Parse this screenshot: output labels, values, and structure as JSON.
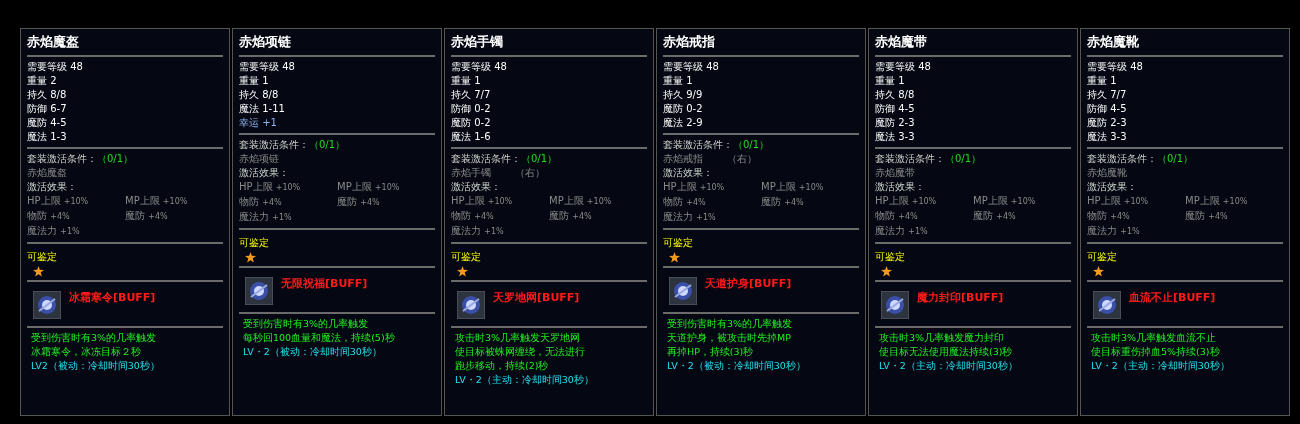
{
  "items": [
    {
      "name": "赤焰魔盔",
      "stats": [
        {
          "label": "需要等级",
          "value": "48",
          "kind": "normal"
        },
        {
          "label": "重量",
          "value": "2",
          "kind": "normal"
        },
        {
          "label": "持久",
          "value": "8/8",
          "kind": "normal"
        },
        {
          "label": "防御",
          "value": "6-7",
          "kind": "normal"
        },
        {
          "label": "魔防",
          "value": "4-5",
          "kind": "normal"
        },
        {
          "label": "魔法",
          "value": "1-3",
          "kind": "normal"
        }
      ],
      "set_condition": "套装激活条件：",
      "set_count": "（0/1）",
      "set_piece": "赤焰魔盔",
      "set_effect_title": "激活效果：",
      "set_effects": [
        {
          "label": "HP上限",
          "value": "+10%"
        },
        {
          "label": "MP上限",
          "value": "+10%"
        },
        {
          "label": "物防",
          "value": "+4%"
        },
        {
          "label": "魔防",
          "value": "+4%"
        },
        {
          "label": "魔法力",
          "value": "+1%"
        }
      ],
      "appraise": "可鉴定",
      "skill": "冰霜寒令[BUFF]",
      "description": [
        "受到伤害时有3%的几率触发",
        "冰霜寒令，冰冻目标２秒"
      ],
      "cooldown": "LV2（被动：冷却时间30秒）"
    },
    {
      "name": "赤焰项链",
      "stats": [
        {
          "label": "需要等级",
          "value": "48",
          "kind": "normal"
        },
        {
          "label": "重量",
          "value": "1",
          "kind": "normal"
        },
        {
          "label": "持久",
          "value": "8/8",
          "kind": "normal"
        },
        {
          "label": "魔法",
          "value": "1-11",
          "kind": "normal"
        },
        {
          "label": "幸运",
          "value": "+1",
          "kind": "luck"
        }
      ],
      "set_condition": "套装激活条件：",
      "set_count": "（0/1）",
      "set_piece": "赤焰项链",
      "set_effect_title": "激活效果：",
      "set_effects": [
        {
          "label": "HP上限",
          "value": "+10%"
        },
        {
          "label": "MP上限",
          "value": "+10%"
        },
        {
          "label": "物防",
          "value": "+4%"
        },
        {
          "label": "魔防",
          "value": "+4%"
        },
        {
          "label": "魔法力",
          "value": "+1%"
        }
      ],
      "appraise": "可鉴定",
      "skill": "无限祝福[BUFF]",
      "description": [
        "受到伤害时有3%的几率触发",
        "每秒回100血量和魔法，持续(5)秒"
      ],
      "cooldown": "LV・2（被动：冷却时间30秒）"
    },
    {
      "name": "赤焰手镯",
      "stats": [
        {
          "label": "需要等级",
          "value": "48",
          "kind": "normal"
        },
        {
          "label": "重量",
          "value": "1",
          "kind": "normal"
        },
        {
          "label": "持久",
          "value": "7/7",
          "kind": "normal"
        },
        {
          "label": "防御",
          "value": "0-2",
          "kind": "normal"
        },
        {
          "label": "魔防",
          "value": "0-2",
          "kind": "normal"
        },
        {
          "label": "魔法",
          "value": "1-6",
          "kind": "normal"
        }
      ],
      "set_condition": "套装激活条件：",
      "set_count": "（0/1）",
      "set_piece": "赤焰手镯",
      "set_side": "（右）",
      "set_effect_title": "激活效果：",
      "set_effects": [
        {
          "label": "HP上限",
          "value": "+10%"
        },
        {
          "label": "MP上限",
          "value": "+10%"
        },
        {
          "label": "物防",
          "value": "+4%"
        },
        {
          "label": "魔防",
          "value": "+4%"
        },
        {
          "label": "魔法力",
          "value": "+1%"
        }
      ],
      "appraise": "可鉴定",
      "skill": "天罗地网[BUFF]",
      "description": [
        "攻击时3%几率触发天罗地网",
        "使目标被蛛网缠绕，无法进行",
        "跑步移动，持续(2)秒"
      ],
      "cooldown": "LV・2（主动：冷却时间30秒）"
    },
    {
      "name": "赤焰戒指",
      "stats": [
        {
          "label": "需要等级",
          "value": "48",
          "kind": "normal"
        },
        {
          "label": "重量",
          "value": "1",
          "kind": "normal"
        },
        {
          "label": "持久",
          "value": "9/9",
          "kind": "normal"
        },
        {
          "label": "魔防",
          "value": "0-2",
          "kind": "normal"
        },
        {
          "label": "魔法",
          "value": "2-9",
          "kind": "normal"
        }
      ],
      "set_condition": "套装激活条件：",
      "set_count": "（0/1）",
      "set_piece": "赤焰戒指",
      "set_side": "（右）",
      "set_effect_title": "激活效果：",
      "set_effects": [
        {
          "label": "HP上限",
          "value": "+10%"
        },
        {
          "label": "MP上限",
          "value": "+10%"
        },
        {
          "label": "物防",
          "value": "+4%"
        },
        {
          "label": "魔防",
          "value": "+4%"
        },
        {
          "label": "魔法力",
          "value": "+1%"
        }
      ],
      "appraise": "可鉴定",
      "skill": "天道护身[BUFF]",
      "description": [
        "受到伤害时有3%的几率触发",
        "天道护身，被攻击时先掉MP",
        "再掉HP，持续(3)秒"
      ],
      "cooldown": "LV・2（被动：冷却时间30秒）"
    },
    {
      "name": "赤焰魔带",
      "stats": [
        {
          "label": "需要等级",
          "value": "48",
          "kind": "normal"
        },
        {
          "label": "重量",
          "value": "1",
          "kind": "normal"
        },
        {
          "label": "持久",
          "value": "8/8",
          "kind": "normal"
        },
        {
          "label": "防御",
          "value": "4-5",
          "kind": "normal"
        },
        {
          "label": "魔防",
          "value": "2-3",
          "kind": "normal"
        },
        {
          "label": "魔法",
          "value": "3-3",
          "kind": "normal"
        }
      ],
      "set_condition": "套装激活条件：",
      "set_count": "（0/1）",
      "set_piece": "赤焰魔带",
      "set_effect_title": "激活效果：",
      "set_effects": [
        {
          "label": "HP上限",
          "value": "+10%"
        },
        {
          "label": "MP上限",
          "value": "+10%"
        },
        {
          "label": "物防",
          "value": "+4%"
        },
        {
          "label": "魔防",
          "value": "+4%"
        },
        {
          "label": "魔法力",
          "value": "+1%"
        }
      ],
      "appraise": "可鉴定",
      "skill": "魔力封印[BUFF]",
      "description": [
        "攻击时3%几率触发魔力封印",
        "使目标无法使用魔法持续(3)秒"
      ],
      "cooldown": "LV・2（主动：冷却时间30秒）"
    },
    {
      "name": "赤焰魔靴",
      "stats": [
        {
          "label": "需要等级",
          "value": "48",
          "kind": "normal"
        },
        {
          "label": "重量",
          "value": "1",
          "kind": "normal"
        },
        {
          "label": "持久",
          "value": "7/7",
          "kind": "normal"
        },
        {
          "label": "防御",
          "value": "4-5",
          "kind": "normal"
        },
        {
          "label": "魔防",
          "value": "2-3",
          "kind": "normal"
        },
        {
          "label": "魔法",
          "value": "3-3",
          "kind": "normal"
        }
      ],
      "set_condition": "套装激活条件：",
      "set_count": "（0/1）",
      "set_piece": "赤焰魔靴",
      "set_effect_title": "激活效果：",
      "set_effects": [
        {
          "label": "HP上限",
          "value": "+10%"
        },
        {
          "label": "MP上限",
          "value": "+10%"
        },
        {
          "label": "物防",
          "value": "+4%"
        },
        {
          "label": "魔防",
          "value": "+4%"
        },
        {
          "label": "魔法力",
          "value": "+1%"
        }
      ],
      "appraise": "可鉴定",
      "skill": "血流不止[BUFF]",
      "description": [
        "攻击时3%几率触发血流不止",
        "使目标重伤掉血5%持续(3)秒"
      ],
      "cooldown": "LV・2（主动：冷却时间30秒）"
    }
  ]
}
